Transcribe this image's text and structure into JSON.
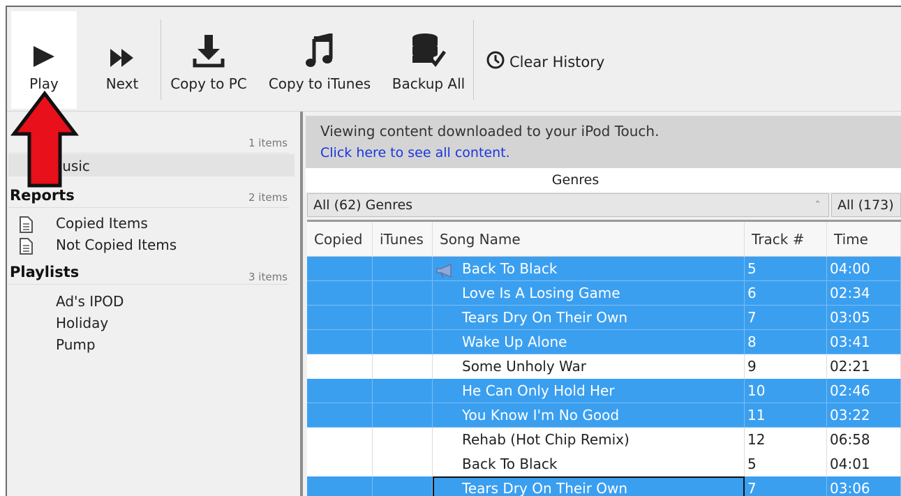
{
  "toolbar": {
    "play_label": "Play",
    "next_label": "Next",
    "copy_pc_label": "Copy to PC",
    "copy_itunes_label": "Copy to iTunes",
    "backup_label": "Backup All",
    "clear_history_label": "Clear History"
  },
  "sidebar": {
    "device": {
      "count": "1 items",
      "items": [
        "Music"
      ]
    },
    "reports": {
      "title": "Reports",
      "count": "2 items",
      "items": [
        "Copied Items",
        "Not Copied Items"
      ]
    },
    "playlists": {
      "title": "Playlists",
      "count": "3 items",
      "items": [
        "Ad's IPOD",
        "Holiday",
        "Pump"
      ]
    }
  },
  "banner": {
    "line1": "Viewing content downloaded to your iPod Touch.",
    "link": "Click here to see all content."
  },
  "filters": {
    "genres_header": "Genres",
    "genre_value": "All (62) Genres",
    "second_value": "All (173)"
  },
  "table": {
    "columns": [
      "Copied",
      "iTunes",
      "Song Name",
      "Track #",
      "Time"
    ],
    "rows": [
      {
        "song": "Back To Black",
        "track": "5",
        "time": "04:00",
        "selected": true,
        "playing": true
      },
      {
        "song": "Love Is A Losing Game",
        "track": "6",
        "time": "02:34",
        "selected": true
      },
      {
        "song": "Tears Dry On Their Own",
        "track": "7",
        "time": "03:05",
        "selected": true
      },
      {
        "song": "Wake Up Alone",
        "track": "8",
        "time": "03:41",
        "selected": true
      },
      {
        "song": "Some Unholy War",
        "track": "9",
        "time": "02:21",
        "selected": false
      },
      {
        "song": "He Can Only Hold Her",
        "track": "10",
        "time": "02:46",
        "selected": true
      },
      {
        "song": "You Know I'm No Good",
        "track": "11",
        "time": "03:22",
        "selected": true
      },
      {
        "song": "Rehab (Hot Chip Remix)",
        "track": "12",
        "time": "06:58",
        "selected": false
      },
      {
        "song": "Back To Black",
        "track": "5",
        "time": "04:01",
        "selected": false
      },
      {
        "song": "Tears Dry On Their Own",
        "track": "7",
        "time": "03:06",
        "selected": true,
        "focused": true
      }
    ]
  },
  "colors": {
    "selection": "#3b9ff0",
    "link": "#1a35e0",
    "arrow": "#e8101a"
  }
}
